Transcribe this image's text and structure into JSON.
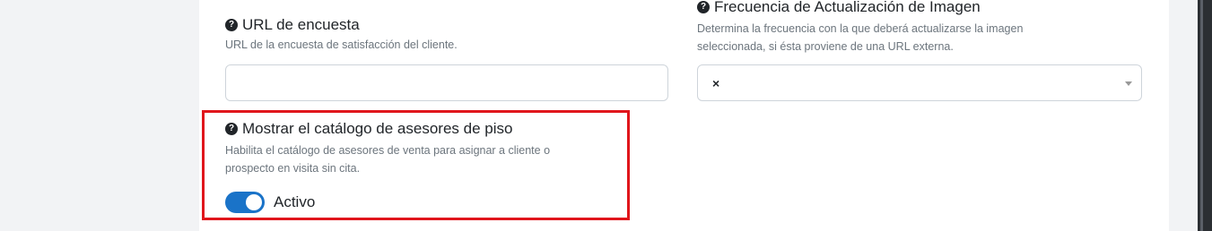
{
  "url_field": {
    "label": "URL de encuesta",
    "description": "URL de la encuesta de satisfacción del cliente.",
    "value": "",
    "help_icon": "question-circle-icon"
  },
  "refresh_field": {
    "label": "Frecuencia de Actualización de Imagen",
    "description_line1": "Determina la frecuencia con la que deberá actualizarse la imagen",
    "description_line2": "seleccionada, si ésta proviene de una URL externa.",
    "clear_glyph": "×",
    "help_icon": "question-circle-icon"
  },
  "catalog_field": {
    "label": "Mostrar el catálogo de asesores de piso",
    "description_line1": "Habilita el catálogo de asesores de venta para asignar a cliente o",
    "description_line2": "prospecto en visita sin cita.",
    "toggle_label": "Activo",
    "toggle_on": true,
    "help_icon": "question-circle-icon"
  },
  "colors": {
    "highlight_border": "#e0161c",
    "toggle_on": "#1a73c8"
  }
}
